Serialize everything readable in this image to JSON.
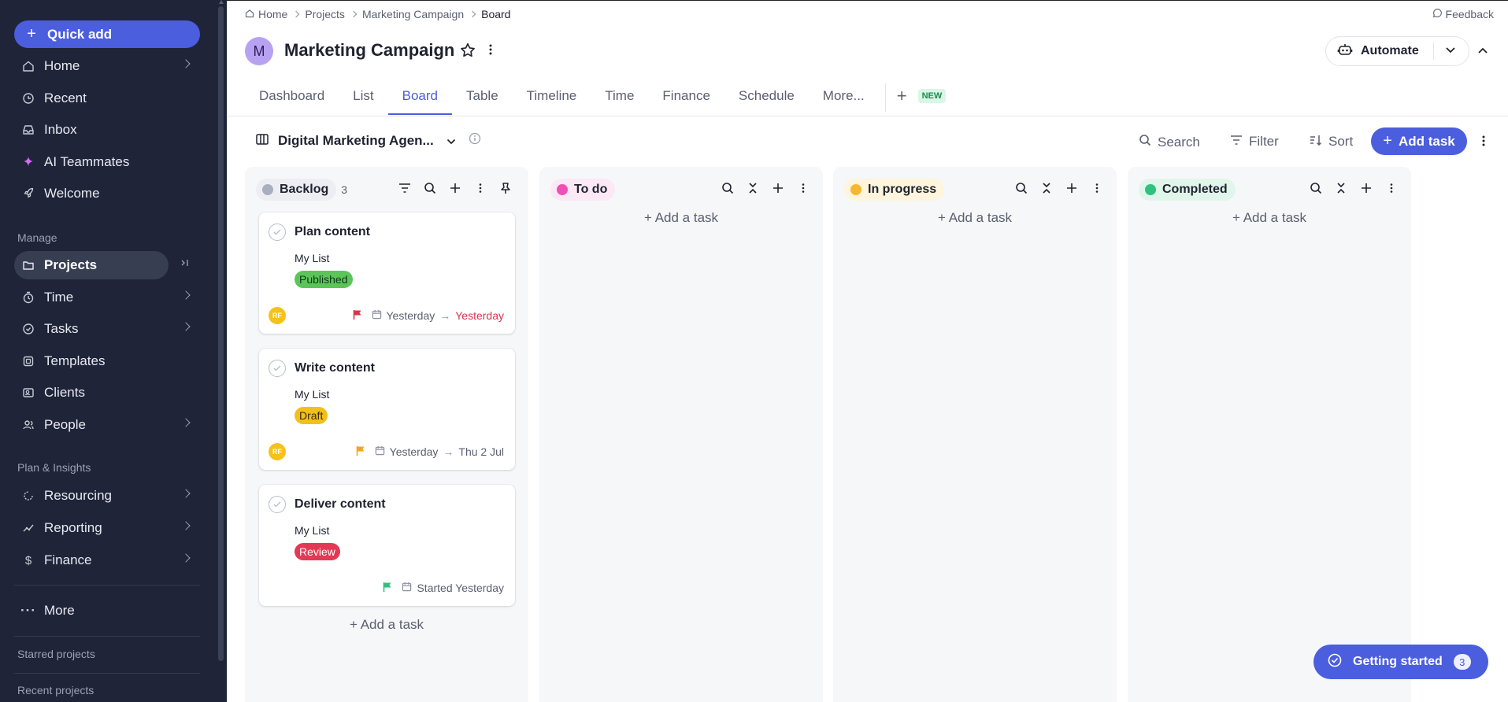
{
  "sidebar": {
    "quick_add": "Quick add",
    "items_top": [
      {
        "label": "Home",
        "icon": "home-icon"
      },
      {
        "label": "Recent",
        "icon": "recent-icon"
      },
      {
        "label": "Inbox",
        "icon": "inbox-icon"
      },
      {
        "label": "AI Teammates",
        "icon": "sparkle-icon"
      },
      {
        "label": "Welcome",
        "icon": "rocket-icon"
      }
    ],
    "manage_label": "Manage",
    "items_manage": [
      {
        "label": "Projects",
        "icon": "folder-icon"
      },
      {
        "label": "Time",
        "icon": "stopwatch-icon"
      },
      {
        "label": "Tasks",
        "icon": "check-circle-icon"
      },
      {
        "label": "Templates",
        "icon": "templates-icon"
      },
      {
        "label": "Clients",
        "icon": "clients-icon"
      },
      {
        "label": "People",
        "icon": "people-icon"
      }
    ],
    "plan_label": "Plan & Insights",
    "items_plan": [
      {
        "label": "Resourcing",
        "icon": "resourcing-icon"
      },
      {
        "label": "Reporting",
        "icon": "reporting-icon"
      },
      {
        "label": "Finance",
        "icon": "dollar-icon"
      }
    ],
    "more": "More",
    "starred": "Starred projects",
    "recent_projects": "Recent projects"
  },
  "breadcrumb": [
    "Home",
    "Projects",
    "Marketing Campaign",
    "Board"
  ],
  "feedback": "Feedback",
  "project": {
    "avatar": "M",
    "title": "Marketing Campaign",
    "automate": "Automate"
  },
  "tabs": [
    "Dashboard",
    "List",
    "Board",
    "Table",
    "Timeline",
    "Time",
    "Finance",
    "Schedule",
    "More..."
  ],
  "active_tab": "Board",
  "new_badge": "NEW",
  "toolbar": {
    "board_name": "Digital Marketing Agen...",
    "search": "Search",
    "filter": "Filter",
    "sort": "Sort",
    "add_task": "Add task"
  },
  "columns": [
    {
      "name": "Backlog",
      "count": "3",
      "color": "#a9aec0",
      "pill_bg": "#eceef3"
    },
    {
      "name": "To do",
      "color": "#f04fb5",
      "pill_bg": "#fde8f5"
    },
    {
      "name": "In progress",
      "color": "#f7b731",
      "pill_bg": "#fff4dc"
    },
    {
      "name": "Completed",
      "color": "#2ec27e",
      "pill_bg": "#e0f6ea"
    }
  ],
  "add_a_task": "Add a task",
  "cards": [
    {
      "title": "Plan content",
      "list": "My List",
      "tag": "Published",
      "tag_bg": "#5cc55a",
      "tag_fg": "#12361a",
      "avatar": "RF",
      "flag_color": "#d9344d",
      "start": "Yesterday",
      "end": "Yesterday"
    },
    {
      "title": "Write content",
      "list": "My List",
      "tag": "Draft",
      "tag_bg": "#f2c01b",
      "tag_fg": "#3a2c00",
      "avatar": "RF",
      "flag_color": "#f2a81b",
      "start": "Yesterday",
      "end": "Thu 2 Jul"
    },
    {
      "title": "Deliver content",
      "list": "My List",
      "tag": "Review",
      "tag_bg": "#e23a55",
      "tag_fg": "#ffffff",
      "flag_color": "#2ec27e",
      "started": "Started Yesterday"
    }
  ],
  "getting_started": {
    "label": "Getting started",
    "count": "3"
  }
}
